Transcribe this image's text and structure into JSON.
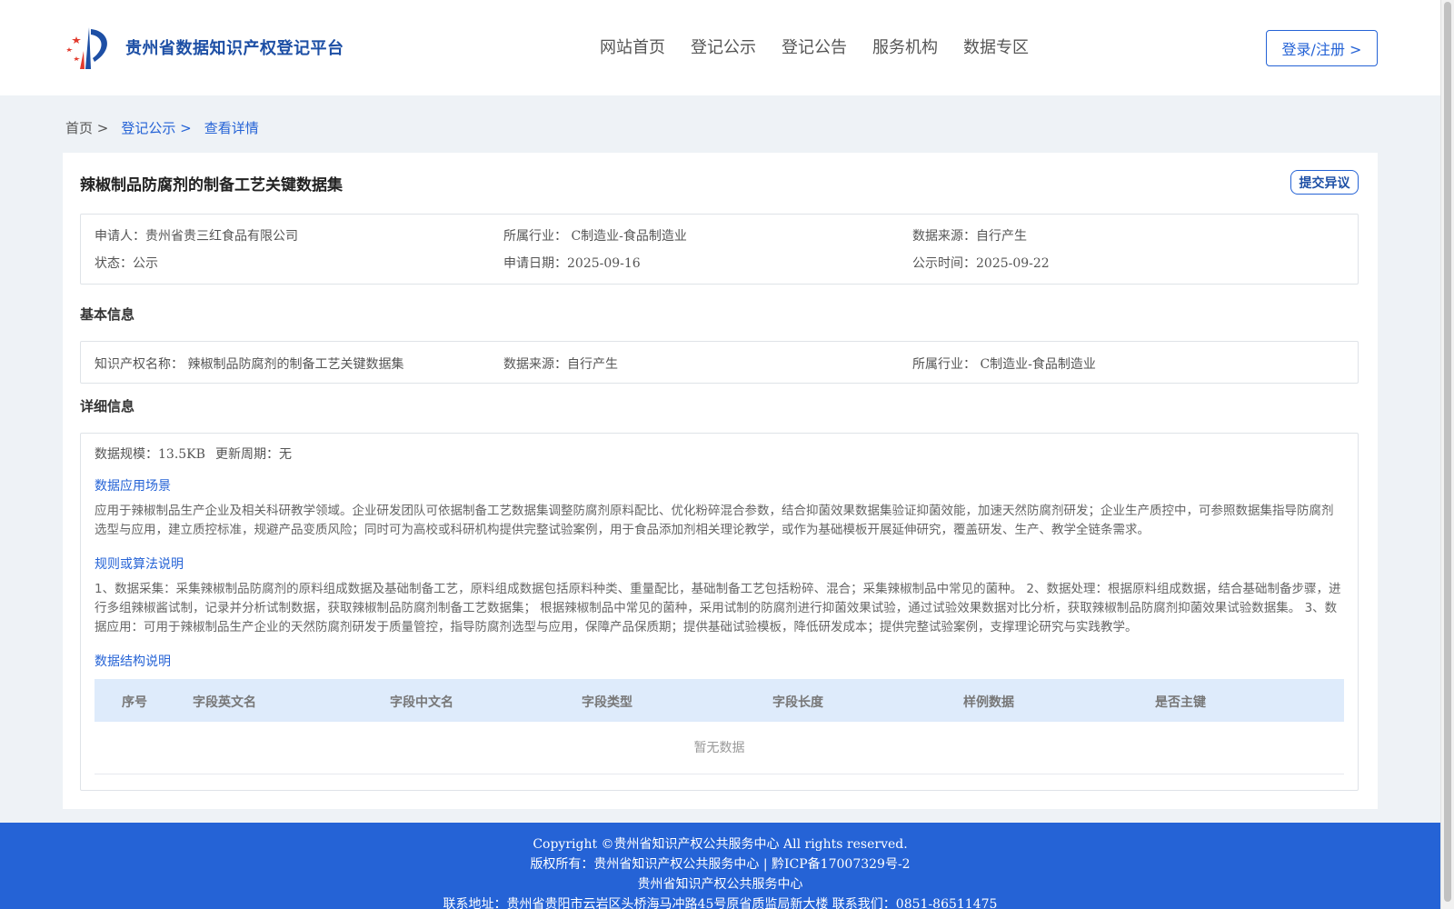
{
  "header": {
    "site_title": "贵州省数据知识产权登记平台",
    "nav": [
      "网站首页",
      "登记公示",
      "登记公告",
      "服务机构",
      "数据专区"
    ],
    "login_label": "登录/注册 >"
  },
  "breadcrumb": {
    "home": "首页 >",
    "publicity": "登记公示 >",
    "current": "查看详情"
  },
  "detail": {
    "title": "辣椒制品防腐剂的制备工艺关键数据集",
    "objection_label": "提交异议",
    "summary": {
      "applicant": "申请人：贵州省贵三红食品有限公司",
      "industry": "所属行业： C制造业-食品制造业",
      "source": "数据来源：自行产生",
      "status": "状态：公示",
      "apply_date": "申请日期：2025-09-16",
      "publicity_time": "公示时间：2025-09-22"
    },
    "basic_heading": "基本信息",
    "basic": {
      "ip_name": "知识产权名称： 辣椒制品防腐剂的制备工艺关键数据集",
      "source": "数据来源：自行产生",
      "industry": "所属行业： C制造业-食品制造业"
    },
    "detail_heading": "详细信息",
    "scale": "数据规模：13.5KB",
    "update_cycle": "更新周期：无",
    "scenario_heading": "数据应用场景",
    "scenario_text": "应用于辣椒制品生产企业及相关科研教学领域。企业研发团队可依据制备工艺数据集调整防腐剂原料配比、优化粉碎混合参数，结合抑菌效果数据集验证抑菌效能，加速天然防腐剂研发；企业生产质控中，可参照数据集指导防腐剂选型与应用，建立质控标准，规避产品变质风险；同时可为高校或科研机构提供完整试验案例，用于食品添加剂相关理论教学，或作为基础模板开展延伸研究，覆盖研发、生产、教学全链条需求。",
    "rules_heading": "规则或算法说明",
    "rules_text": "1、数据采集：采集辣椒制品防腐剂的原料组成数据及基础制备工艺，原料组成数据包括原料种类、重量配比，基础制备工艺包括粉碎、混合；采集辣椒制品中常见的菌种。 2、数据处理：根据原料组成数据，结合基础制备步骤，进行多组辣椒酱试制，记录并分析试制数据，获取辣椒制品防腐剂制备工艺数据集； 根据辣椒制品中常见的菌种，采用试制的防腐剂进行抑菌效果试验，通过试验效果数据对比分析，获取辣椒制品防腐剂抑菌效果试验数据集。 3、数据应用：可用于辣椒制品生产企业的天然防腐剂研发于质量管控，指导防腐剂选型与应用，保障产品保质期；提供基础试验模板，降低研发成本；提供完整试验案例，支撑理论研究与实践教学。",
    "structure_heading": "数据结构说明",
    "table_columns": [
      "序号",
      "字段英文名",
      "字段中文名",
      "字段类型",
      "字段长度",
      "样例数据",
      "是否主键"
    ],
    "empty_text": "暂无数据"
  },
  "footer": {
    "copyright": "Copyright ©贵州省知识产权公共服务中心 All rights reserved.",
    "owner": "版权所有：贵州省知识产权公共服务中心 | 黔ICP备17007329号-2",
    "org": "贵州省知识产权公共服务中心",
    "contact": "联系地址：贵州省贵阳市云岩区头桥海马冲路45号原省质监局新大楼 联系我们：0851-86511475"
  },
  "colors": {
    "primary": "#2563d6",
    "footer_bg": "#2563d6",
    "table_head_bg": "#deebfb"
  }
}
